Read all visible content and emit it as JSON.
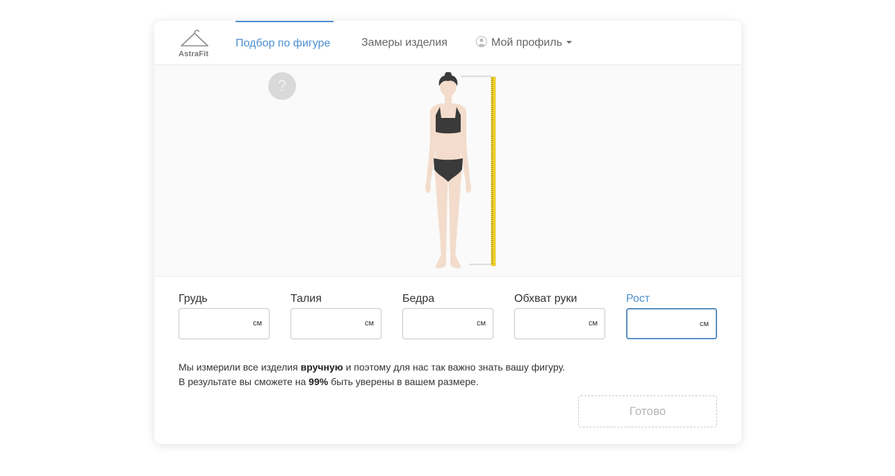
{
  "brand": {
    "name": "AstraFit"
  },
  "nav": {
    "tabs": [
      {
        "label": "Подбор по фигуре",
        "active": true
      },
      {
        "label": "Замеры изделия",
        "active": false
      }
    ],
    "profile": {
      "label": "Мой профиль",
      "icon": "user-icon"
    }
  },
  "stage": {
    "help_symbol": "?"
  },
  "fields": [
    {
      "label": "Грудь",
      "unit": "см",
      "value": ""
    },
    {
      "label": "Талия",
      "unit": "см",
      "value": ""
    },
    {
      "label": "Бедра",
      "unit": "см",
      "value": ""
    },
    {
      "label": "Обхват руки",
      "unit": "см",
      "value": ""
    },
    {
      "label": "Рост",
      "unit": "см",
      "value": "",
      "focused": true
    }
  ],
  "info": {
    "line1_a": "Мы измерили все изделия ",
    "line1_bold": "вручную",
    "line1_b": " и поэтому для нас так важно знать вашу фигуру.",
    "line2_a": "В результате вы сможете на ",
    "line2_bold": "99%",
    "line2_b": " быть уверены в вашем размере."
  },
  "actions": {
    "done_label": "Готово"
  },
  "colors": {
    "accent": "#4a8fd0",
    "tape": "#f2d22e",
    "skin": "#f3dccb",
    "garment": "#3a3a3a"
  }
}
